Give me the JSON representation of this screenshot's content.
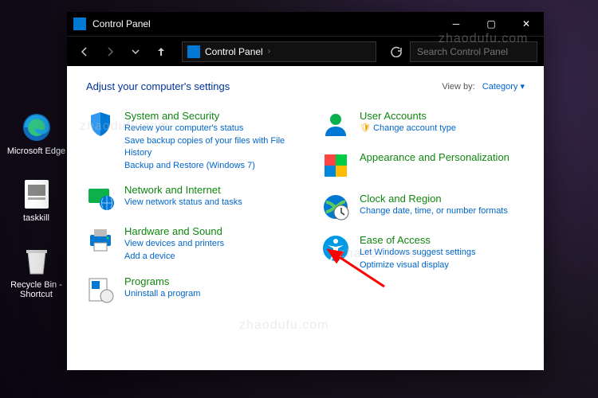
{
  "desktop": {
    "icons": [
      {
        "label": "Microsoft Edge"
      },
      {
        "label": "taskkill"
      },
      {
        "label": "Recycle Bin - Shortcut"
      }
    ]
  },
  "window": {
    "title": "Control Panel",
    "breadcrumb": "Control Panel",
    "search_placeholder": "Search Control Panel"
  },
  "content": {
    "heading": "Adjust your computer's settings",
    "viewby_label": "View by:",
    "viewby_value": "Category",
    "left": [
      {
        "title": "System and Security",
        "links": [
          "Review your computer's status",
          "Save backup copies of your files with File History",
          "Backup and Restore (Windows 7)"
        ]
      },
      {
        "title": "Network and Internet",
        "links": [
          "View network status and tasks"
        ]
      },
      {
        "title": "Hardware and Sound",
        "links": [
          "View devices and printers",
          "Add a device"
        ]
      },
      {
        "title": "Programs",
        "links": [
          "Uninstall a program"
        ]
      }
    ],
    "right": [
      {
        "title": "User Accounts",
        "links": [
          "Change account type"
        ]
      },
      {
        "title": "Appearance and Personalization",
        "links": []
      },
      {
        "title": "Clock and Region",
        "links": [
          "Change date, time, or number formats"
        ]
      },
      {
        "title": "Ease of Access",
        "links": [
          "Let Windows suggest settings",
          "Optimize visual display"
        ]
      }
    ]
  }
}
